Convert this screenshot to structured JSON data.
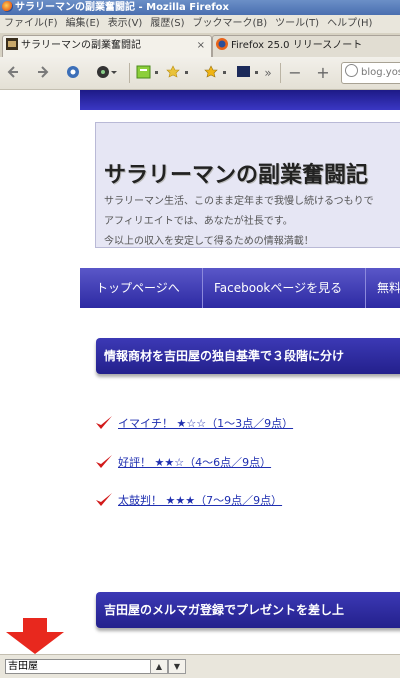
{
  "window": {
    "title": "サラリーマンの副業奮闘記 - Mozilla Firefox"
  },
  "menu": [
    "ファイル(F)",
    "編集(E)",
    "表示(V)",
    "履歴(S)",
    "ブックマーク(B)",
    "ツール(T)",
    "ヘルプ(H)"
  ],
  "tabs": [
    {
      "label": "サラリーマンの副業奮闘記",
      "close": "×"
    },
    {
      "label": "Firefox 25.0 リリースノート"
    }
  ],
  "toolbar": {
    "more": "»",
    "zoom_out": "−",
    "zoom_in": "+",
    "url": "blog.yos"
  },
  "site": {
    "title": "サラリーマンの副業奮闘記",
    "desc1": "サラリーマン生活、このまま定年まで我慢し続けるつもりで",
    "desc2": "アフィリエイトでは、あなたが社長です。",
    "desc3": "今以上の収入を安定して得るための情報満載！"
  },
  "nav": [
    "トップページへ",
    "Facebookページを見る",
    "無料"
  ],
  "section1": {
    "title": "情報商材を吉田屋の独自基準で３段階に分け"
  },
  "list": [
    "イマイチ！ ★☆☆（1～3点／9点）",
    "好評！ ★★☆（4～6点／9点）",
    "太鼓判！ ★★★（7～9点／9点）"
  ],
  "section2": {
    "title": "吉田屋のメルマガ登録でプレゼントを差し上"
  },
  "findbar": {
    "value": "吉田屋",
    "prev": "▲",
    "next": "▼"
  },
  "colors": {
    "accent": "#2d2aa3",
    "arrow": "#e8281e",
    "link": "#1f2fb0"
  }
}
